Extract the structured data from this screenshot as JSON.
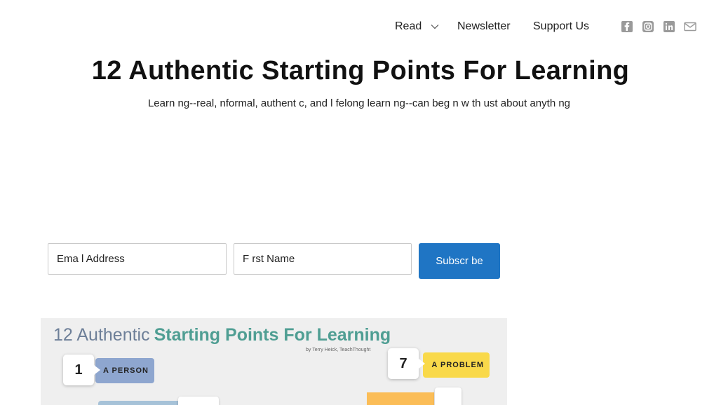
{
  "nav": {
    "read_label": "Read",
    "newsletter_label": "Newsletter",
    "support_label": "Support Us"
  },
  "social": [
    "facebook-icon",
    "instagram-icon",
    "linkedin-icon",
    "mail-icon"
  ],
  "article": {
    "title": "12 Authentic Starting Points For Learning",
    "subtitle": "Learn ng--real,  nformal, authent c, and l felong learn ng--can  beg n  w th  ust about anyth ng"
  },
  "signup": {
    "email_placeholder": "Ema l Address",
    "name_placeholder": "F rst Name",
    "button_label": "Subscr be"
  },
  "infographic": {
    "title_prefix": "12 Authentic",
    "title_main": "Starting Points For Learning",
    "byline": "by Terry Heick, TeachThought",
    "items": [
      {
        "number": "1",
        "label": "A PERSON"
      },
      {
        "number": "7",
        "label": "A PROBLEM"
      }
    ],
    "colors": {
      "title_prefix": "#6d7f98",
      "title_main": "#4f9e93",
      "person": "#8ea6cf",
      "problem": "#f9d94a"
    }
  },
  "colors": {
    "accent": "#1f75c4"
  }
}
